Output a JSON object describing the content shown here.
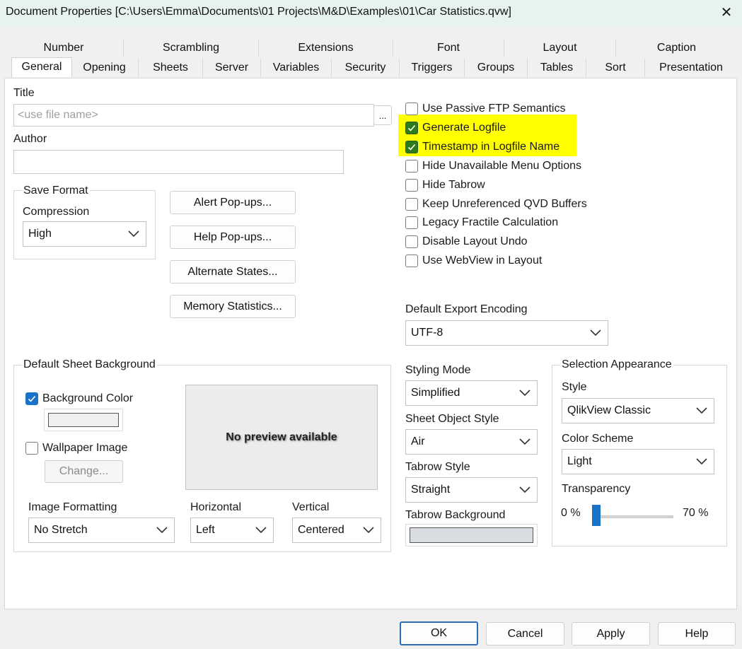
{
  "window": {
    "title": "Document Properties [C:\\Users\\Emma\\Documents\\01 Projects\\M&D\\Examples\\01\\Car Statistics.qvw]",
    "close_glyph": "✕"
  },
  "tabs_back": [
    "Number",
    "Scrambling",
    "Extensions",
    "Font",
    "Layout",
    "Caption"
  ],
  "tabs_front": [
    "General",
    "Opening",
    "Sheets",
    "Server",
    "Variables",
    "Security",
    "Triggers",
    "Groups",
    "Tables",
    "Sort",
    "Presentation"
  ],
  "selected_tab": "General",
  "general": {
    "title_label": "Title",
    "title_placeholder": "<use file name>",
    "title_value": "",
    "ellipsis_label": "...",
    "author_label": "Author",
    "author_value": "",
    "save_format": {
      "group_label": "Save Format",
      "compression_label": "Compression",
      "compression_value": "High"
    },
    "buttons": {
      "alert": "Alert Pop-ups...",
      "help": "Help Pop-ups...",
      "alternate": "Alternate States...",
      "memory": "Memory Statistics..."
    },
    "options": [
      {
        "label": "Use Passive FTP Semantics",
        "checked": false
      },
      {
        "label": "Generate Logfile",
        "checked": true
      },
      {
        "label": "Timestamp in Logfile Name",
        "checked": true
      },
      {
        "label": "Hide Unavailable Menu Options",
        "checked": false
      },
      {
        "label": "Hide Tabrow",
        "checked": false
      },
      {
        "label": "Keep Unreferenced QVD Buffers",
        "checked": false
      },
      {
        "label": "Legacy Fractile Calculation",
        "checked": false
      },
      {
        "label": "Disable Layout Undo",
        "checked": false
      },
      {
        "label": "Use WebView in Layout",
        "checked": false
      }
    ],
    "export_encoding": {
      "label": "Default Export Encoding",
      "value": "UTF-8"
    },
    "sheet_background": {
      "group_label": "Default Sheet Background",
      "background_color_label": "Background Color",
      "background_color_checked": true,
      "wallpaper_label": "Wallpaper Image",
      "wallpaper_checked": false,
      "change_label": "Change...",
      "preview_text": "No preview available",
      "image_formatting_label": "Image Formatting",
      "image_formatting_value": "No Stretch",
      "horizontal_label": "Horizontal",
      "horizontal_value": "Left",
      "vertical_label": "Vertical",
      "vertical_value": "Centered"
    },
    "styling": {
      "styling_mode_label": "Styling Mode",
      "styling_mode_value": "Simplified",
      "sheet_object_style_label": "Sheet Object Style",
      "sheet_object_style_value": "Air",
      "tabrow_style_label": "Tabrow Style",
      "tabrow_style_value": "Straight",
      "tabrow_background_label": "Tabrow Background"
    },
    "selection": {
      "group_label": "Selection Appearance",
      "style_label": "Style",
      "style_value": "QlikView Classic",
      "color_scheme_label": "Color Scheme",
      "color_scheme_value": "Light",
      "transparency_label": "Transparency",
      "min_label": "0 %",
      "max_label": "70 %",
      "transparency_fraction": 0.0
    }
  },
  "footer": {
    "ok": "OK",
    "cancel": "Cancel",
    "apply": "Apply",
    "help": "Help"
  },
  "colors": {
    "titlebar": "#e6f3ee",
    "highlight": "#ffff00",
    "accent": "#1a73c8",
    "checked_dark": "#2e7a1e"
  }
}
